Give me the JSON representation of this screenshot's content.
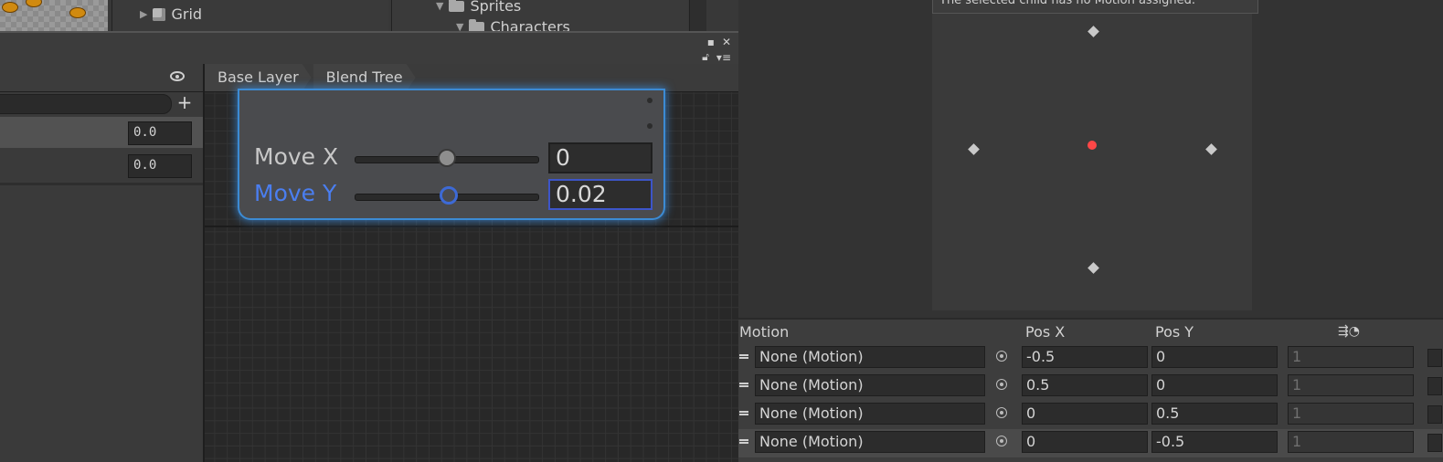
{
  "hierarchy": {
    "items": [
      {
        "label": "Grid"
      }
    ]
  },
  "project": {
    "items": [
      {
        "label": "Sprites"
      },
      {
        "label": "Characters"
      }
    ]
  },
  "animator": {
    "breadcrumb": [
      "Base Layer",
      "Blend Tree"
    ],
    "parameters": [
      {
        "value": "0.0"
      },
      {
        "value": "0.0"
      }
    ],
    "node": {
      "sliders": [
        {
          "label": "Move X",
          "value": "0",
          "fraction": 0.5,
          "active": false
        },
        {
          "label": "Move Y",
          "value": "0.02",
          "fraction": 0.51,
          "active": true
        }
      ]
    }
  },
  "inspector": {
    "message": "The selected child has no Motion assigned.",
    "columns": {
      "motion": "Motion",
      "pos_x": "Pos X",
      "pos_y": "Pos Y"
    },
    "rows": [
      {
        "motion": "None (Motion)",
        "pos_x": "-0.5",
        "pos_y": "0",
        "speed": "1"
      },
      {
        "motion": "None (Motion)",
        "pos_x": "0.5",
        "pos_y": "0",
        "speed": "1"
      },
      {
        "motion": "None (Motion)",
        "pos_x": "0",
        "pos_y": "0.5",
        "speed": "1"
      },
      {
        "motion": "None (Motion)",
        "pos_x": "0",
        "pos_y": "-0.5",
        "speed": "1"
      }
    ]
  },
  "colors": {
    "accent": "#3d6ad6",
    "selection_glow": "#3c8bd4",
    "current_point": "#ff4747"
  },
  "icons": [
    "eye-icon",
    "plus-icon",
    "maximize-icon",
    "close-icon",
    "lock-icon",
    "menu-icon",
    "object-picker-icon",
    "drag-handle-icon",
    "timer-icon",
    "cube-icon",
    "folder-icon"
  ]
}
